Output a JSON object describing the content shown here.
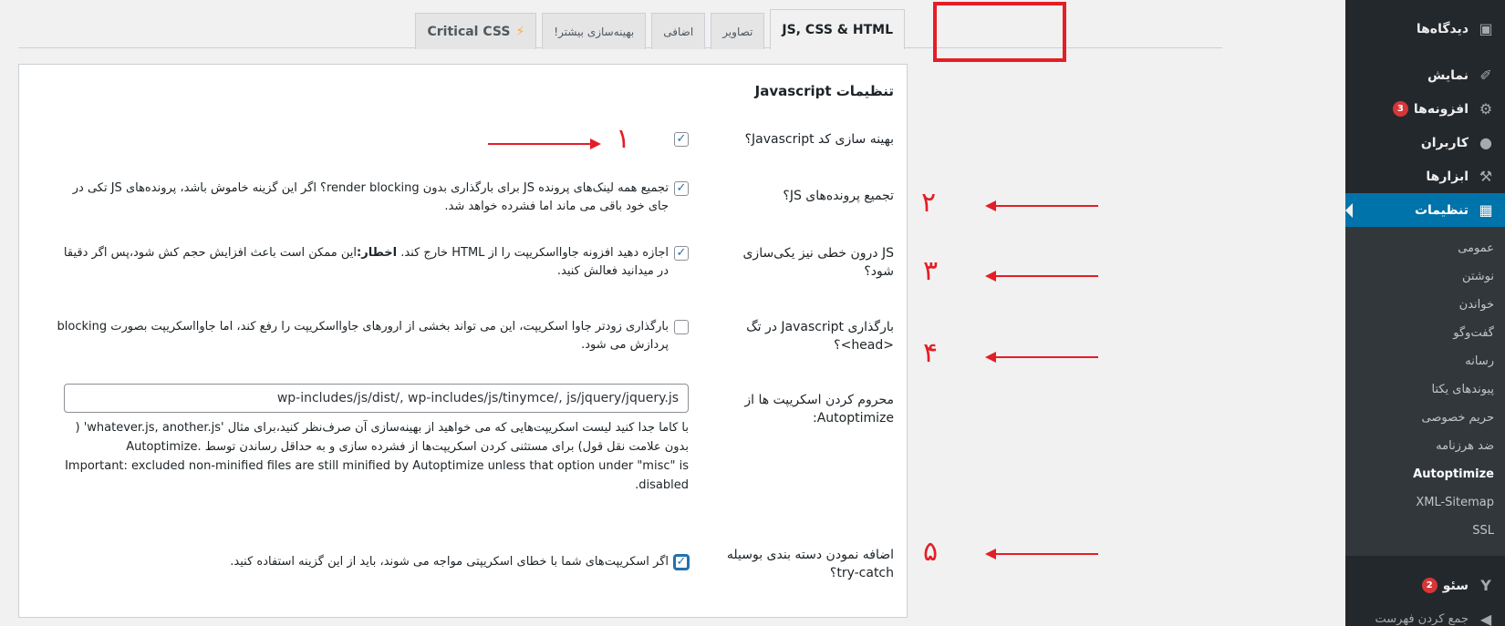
{
  "tabs": [
    {
      "label": "JS, CSS & HTML",
      "active": true
    },
    {
      "label": "تصاویر"
    },
    {
      "label": "اضافی"
    },
    {
      "label": "بهینه‌سازی بیشتر!"
    },
    {
      "label": "Critical CSS",
      "icon": "lightning-icon"
    }
  ],
  "panel": {
    "title": "تنظیمات Javascript",
    "optimize_js": {
      "label": "بهینه سازی کد Javascript؟",
      "checked": true
    },
    "aggregate_js": {
      "label": "تجمیع پرونده‌های JS؟",
      "checked": true,
      "desc": "تجمیع همه لینک‌های پرونده JS برای بارگذاری بدون render blocking؟ اگر این گزینه خاموش باشد، پرونده‌های JS تکی در جای خود باقی می ماند اما فشرده خواهد شد."
    },
    "inline_js": {
      "label": "JS درون خطی نیز یکی‌سازی شود؟",
      "checked": true,
      "desc_prefix": "اجازه دهید افزونه جاوااسکریپت را از HTML خارج کند. ",
      "desc_bold": "اخطار:",
      "desc_suffix": "این ممکن است باعث افزایش حجم کش شود،پس اگر دقیقا در میدانید فعالش کنید."
    },
    "defer_head": {
      "label": "بارگذاری Javascript در تگ <head>؟",
      "checked": false,
      "desc": "بارگذاری زودتر جاوا اسکریپت، این می تواند بخشی از ارورهای جاوااسکریپت را رفع کند، اما جاوااسکریپت بصورت blocking پردازش می شود."
    },
    "exclude": {
      "label": "محروم کردن اسکریپت ها از Autoptimize:",
      "value": "wp-includes/js/dist/, wp-includes/js/tinymce/, js/jquery/jquery.js",
      "desc": "با کاما جدا کنید لیست اسکریپت‌هایی که می خواهید از بهینه‌سازی آن صرف‌نظر کنید،برای مثال 'whatever.js, another.js' ( بدون علامت نقل قول) برای مستثنی کردن اسکریپت‌ها از فشرده سازی و به حداقل رساندن توسط Autoptimize. Important: excluded non-minified files are still minified by Autoptimize unless that option under \"misc\" is disabled."
    },
    "try_catch": {
      "label": "اضافه نمودن دسته بندی بوسیله try-catch؟",
      "checked": true,
      "desc": "اگر اسکریپت‌های شما با خطای اسکریپتی مواجه می شوند، باید از این گزینه استفاده کنید."
    }
  },
  "annotations": [
    "۱",
    "۲",
    "۳",
    "۴",
    "۵"
  ],
  "sidebar": {
    "top": [
      {
        "label": "دیدگاه‌ها",
        "icon": "comment-icon"
      },
      {
        "label": "نمایش",
        "icon": "brush-icon"
      },
      {
        "label": "افزونه‌ها",
        "icon": "plugin-icon",
        "badge": "3"
      },
      {
        "label": "کاربران",
        "icon": "user-icon"
      },
      {
        "label": "ابزارها",
        "icon": "wrench-icon"
      },
      {
        "label": "تنظیمات",
        "icon": "settings-icon",
        "active": true
      }
    ],
    "submenu": [
      "عمومی",
      "نوشتن",
      "خواندن",
      "گفت‌وگو",
      "رسانه",
      "پیوندهای یکتا",
      "حریم خصوصی",
      "ضد هرزنامه",
      "Autoptimize",
      "XML-Sitemap",
      "SSL"
    ],
    "bottom": [
      {
        "label": "سئو",
        "icon": "yoast-icon",
        "badge": "2"
      },
      {
        "label": "جمع کردن فهرست",
        "icon": "collapse-icon"
      }
    ]
  },
  "colors": {
    "accent": "#0073aa",
    "annotation": "#e41e26",
    "sidebar_bg": "#23282d"
  }
}
